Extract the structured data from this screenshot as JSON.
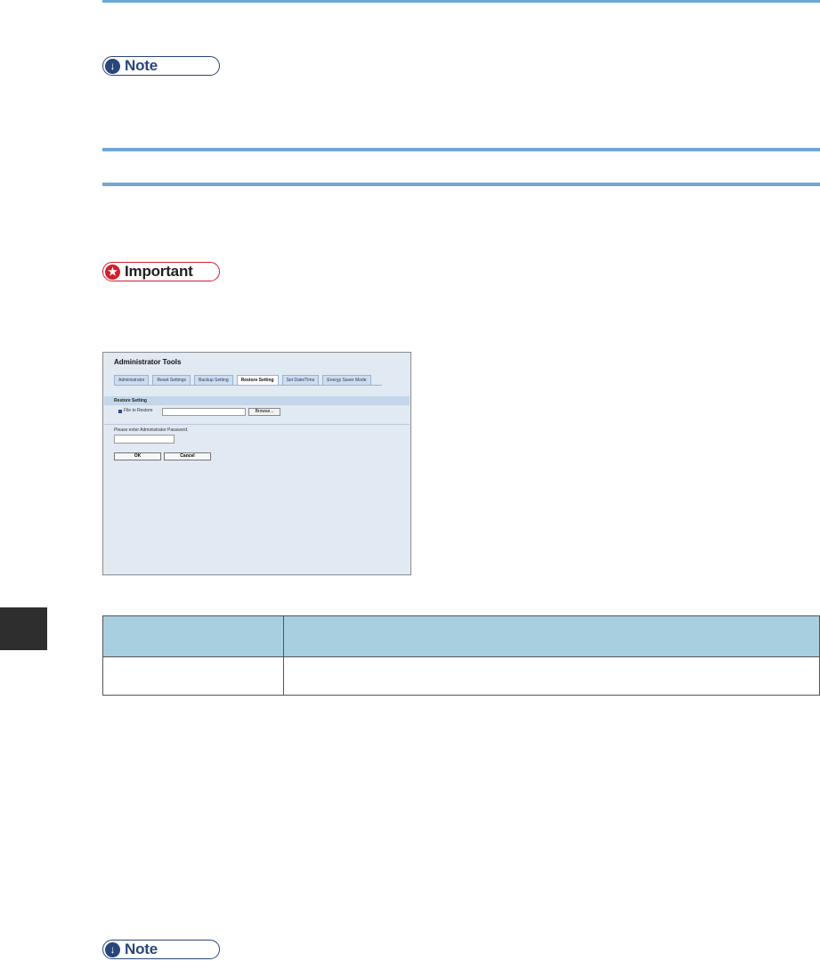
{
  "badges": {
    "note_top": "Note",
    "important": "Important",
    "note_bottom": "Note"
  },
  "screenshot": {
    "title": "Administrator Tools",
    "tabs": [
      "Administrator",
      "Reset Settings",
      "Backup Setting",
      "Restore Setting",
      "Set Date/Time",
      "Energy Saver Mode"
    ],
    "active_tab": "Restore Setting",
    "section_title": "Restore Setting",
    "file_label": "File to Restore",
    "browse_label": "Browse...",
    "password_label": "Please enter Administrator Password.",
    "ok_label": "OK",
    "cancel_label": "Cancel"
  },
  "table": {
    "headers": [
      "",
      ""
    ],
    "rows": [
      [
        "",
        ""
      ]
    ]
  },
  "colors": {
    "rule": "#6fa8d6",
    "note": "#29467a",
    "important": "#d0202e",
    "table_header": "#a8cfe0"
  }
}
